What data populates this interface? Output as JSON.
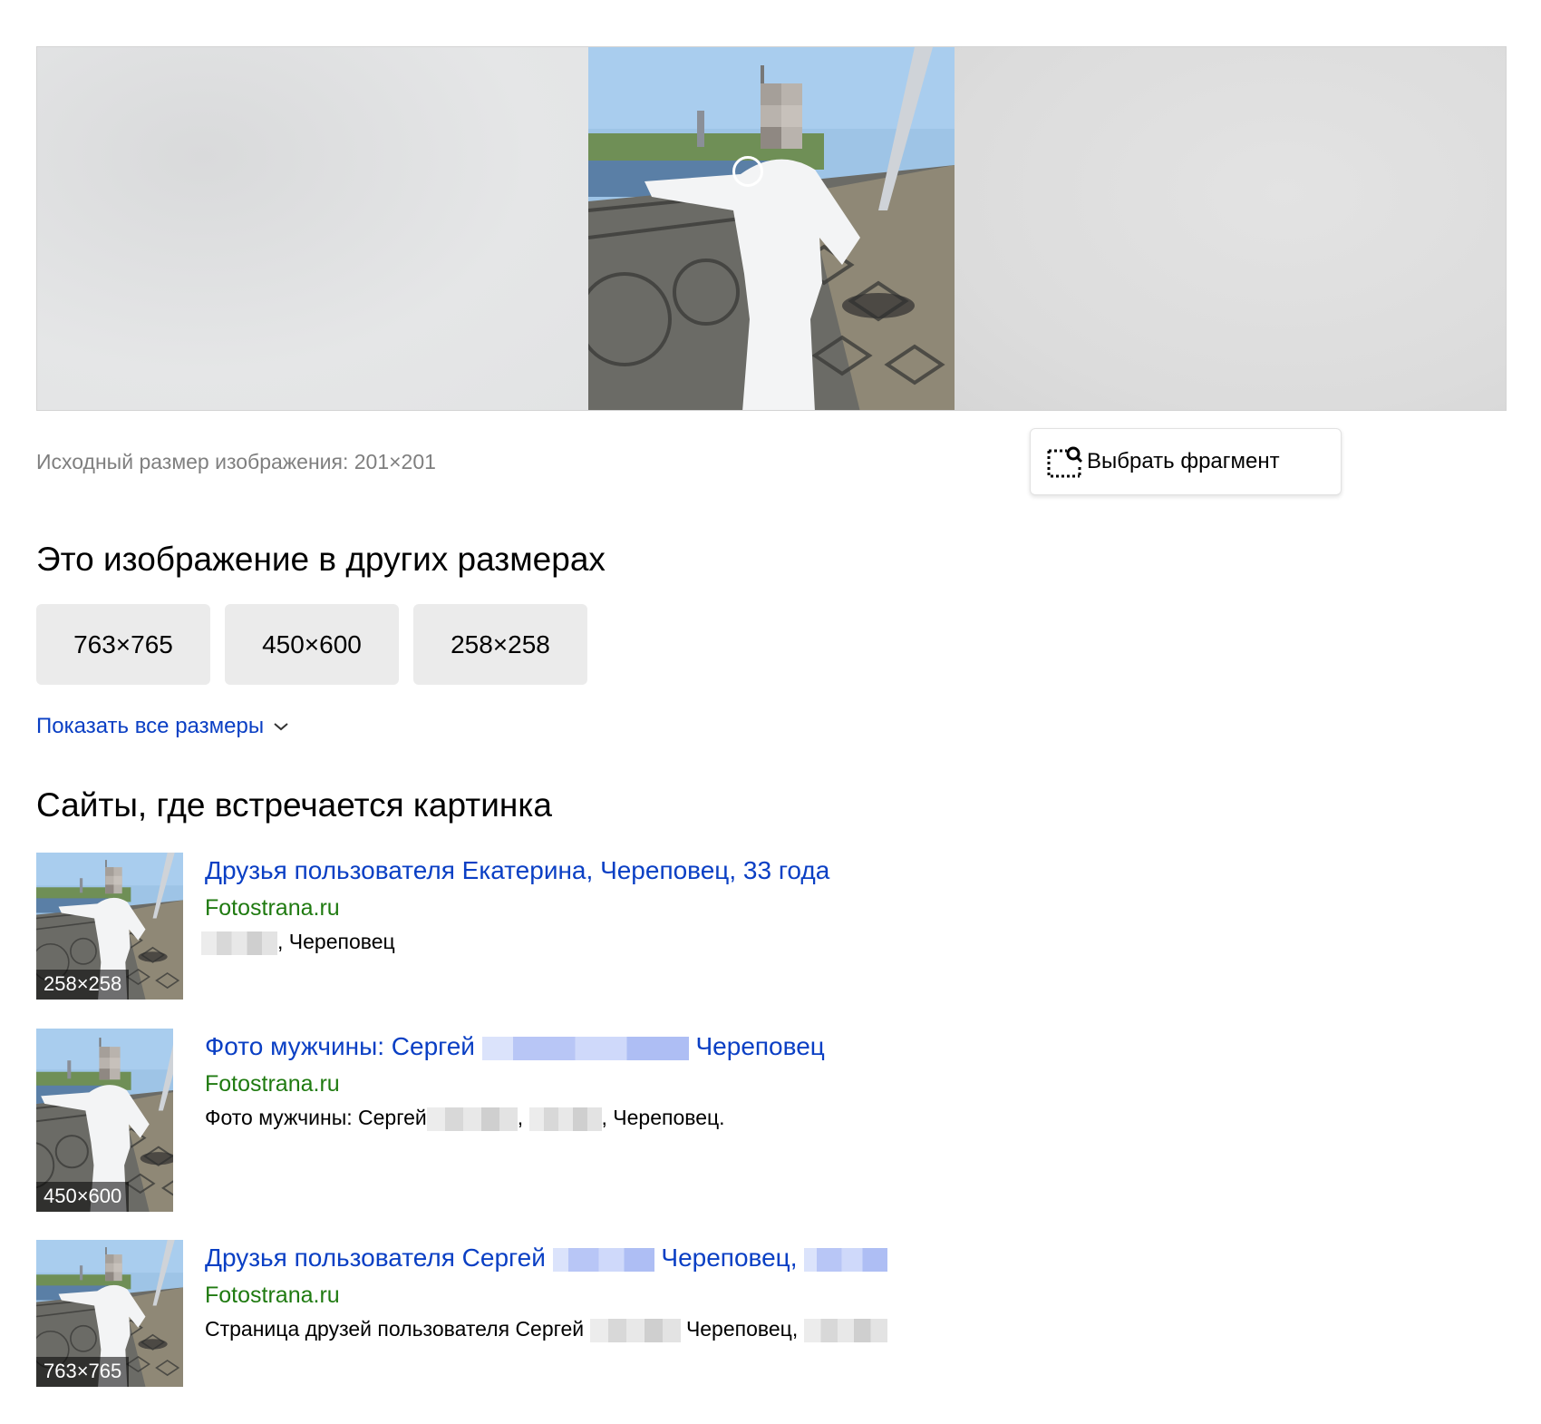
{
  "preview": {
    "original_size_text": "Исходный размер изображения: 201×201",
    "crop_button_label": "Выбрать фрагмент"
  },
  "sizes_section": {
    "heading": "Это изображение в других размерах",
    "sizes": [
      "763×765",
      "450×600",
      "258×258"
    ],
    "show_all_label": "Показать все размеры"
  },
  "sites_section": {
    "heading": "Сайты, где встречается картинка",
    "results": [
      {
        "thumb_size": "258×258",
        "title": "Друзья пользователя Екатерина, Череповец, 33 года",
        "domain": "Fotostrana.ru",
        "desc_text": ", Череповец"
      },
      {
        "thumb_size": "450×600",
        "title_a": "Фото мужчины: Сергей",
        "title_b": "Череповец",
        "domain": "Fotostrana.ru",
        "desc_a": "Фото мужчины: Сергей",
        "desc_b": ",",
        "desc_c": ", Череповец."
      },
      {
        "thumb_size": "763×765",
        "title_a": "Друзья пользователя Сергей",
        "title_b": "Череповец,",
        "domain": "Fotostrana.ru",
        "desc_a": "Страница друзей пользователя Сергей",
        "desc_b": "Череповец,"
      }
    ]
  },
  "colors": {
    "link": "#0a3fc4",
    "domain": "#1f7a10",
    "muted": "#7f7f7f",
    "chip_bg": "#ebebeb"
  }
}
